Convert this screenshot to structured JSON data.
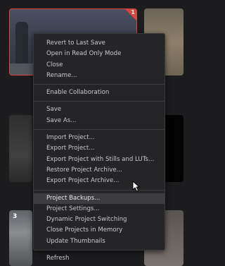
{
  "thumbnails": {
    "badge_number": "1",
    "tile_number": "3"
  },
  "context_menu": {
    "groups": [
      [
        "Revert to Last Save",
        "Open in Read Only Mode",
        "Close",
        "Rename..."
      ],
      [
        "Enable Collaboration"
      ],
      [
        "Save",
        "Save As..."
      ],
      [
        "Import Project...",
        "Export Project...",
        "Export Project with Stills and LUTs...",
        "Restore Project Archive...",
        "Export Project Archive..."
      ],
      [
        "Project Backups...",
        "Project Settings...",
        "Dynamic Project Switching",
        "Close Projects in Memory",
        "Update Thumbnails"
      ],
      [
        "Refresh"
      ]
    ],
    "highlighted_item": "Project Backups..."
  }
}
